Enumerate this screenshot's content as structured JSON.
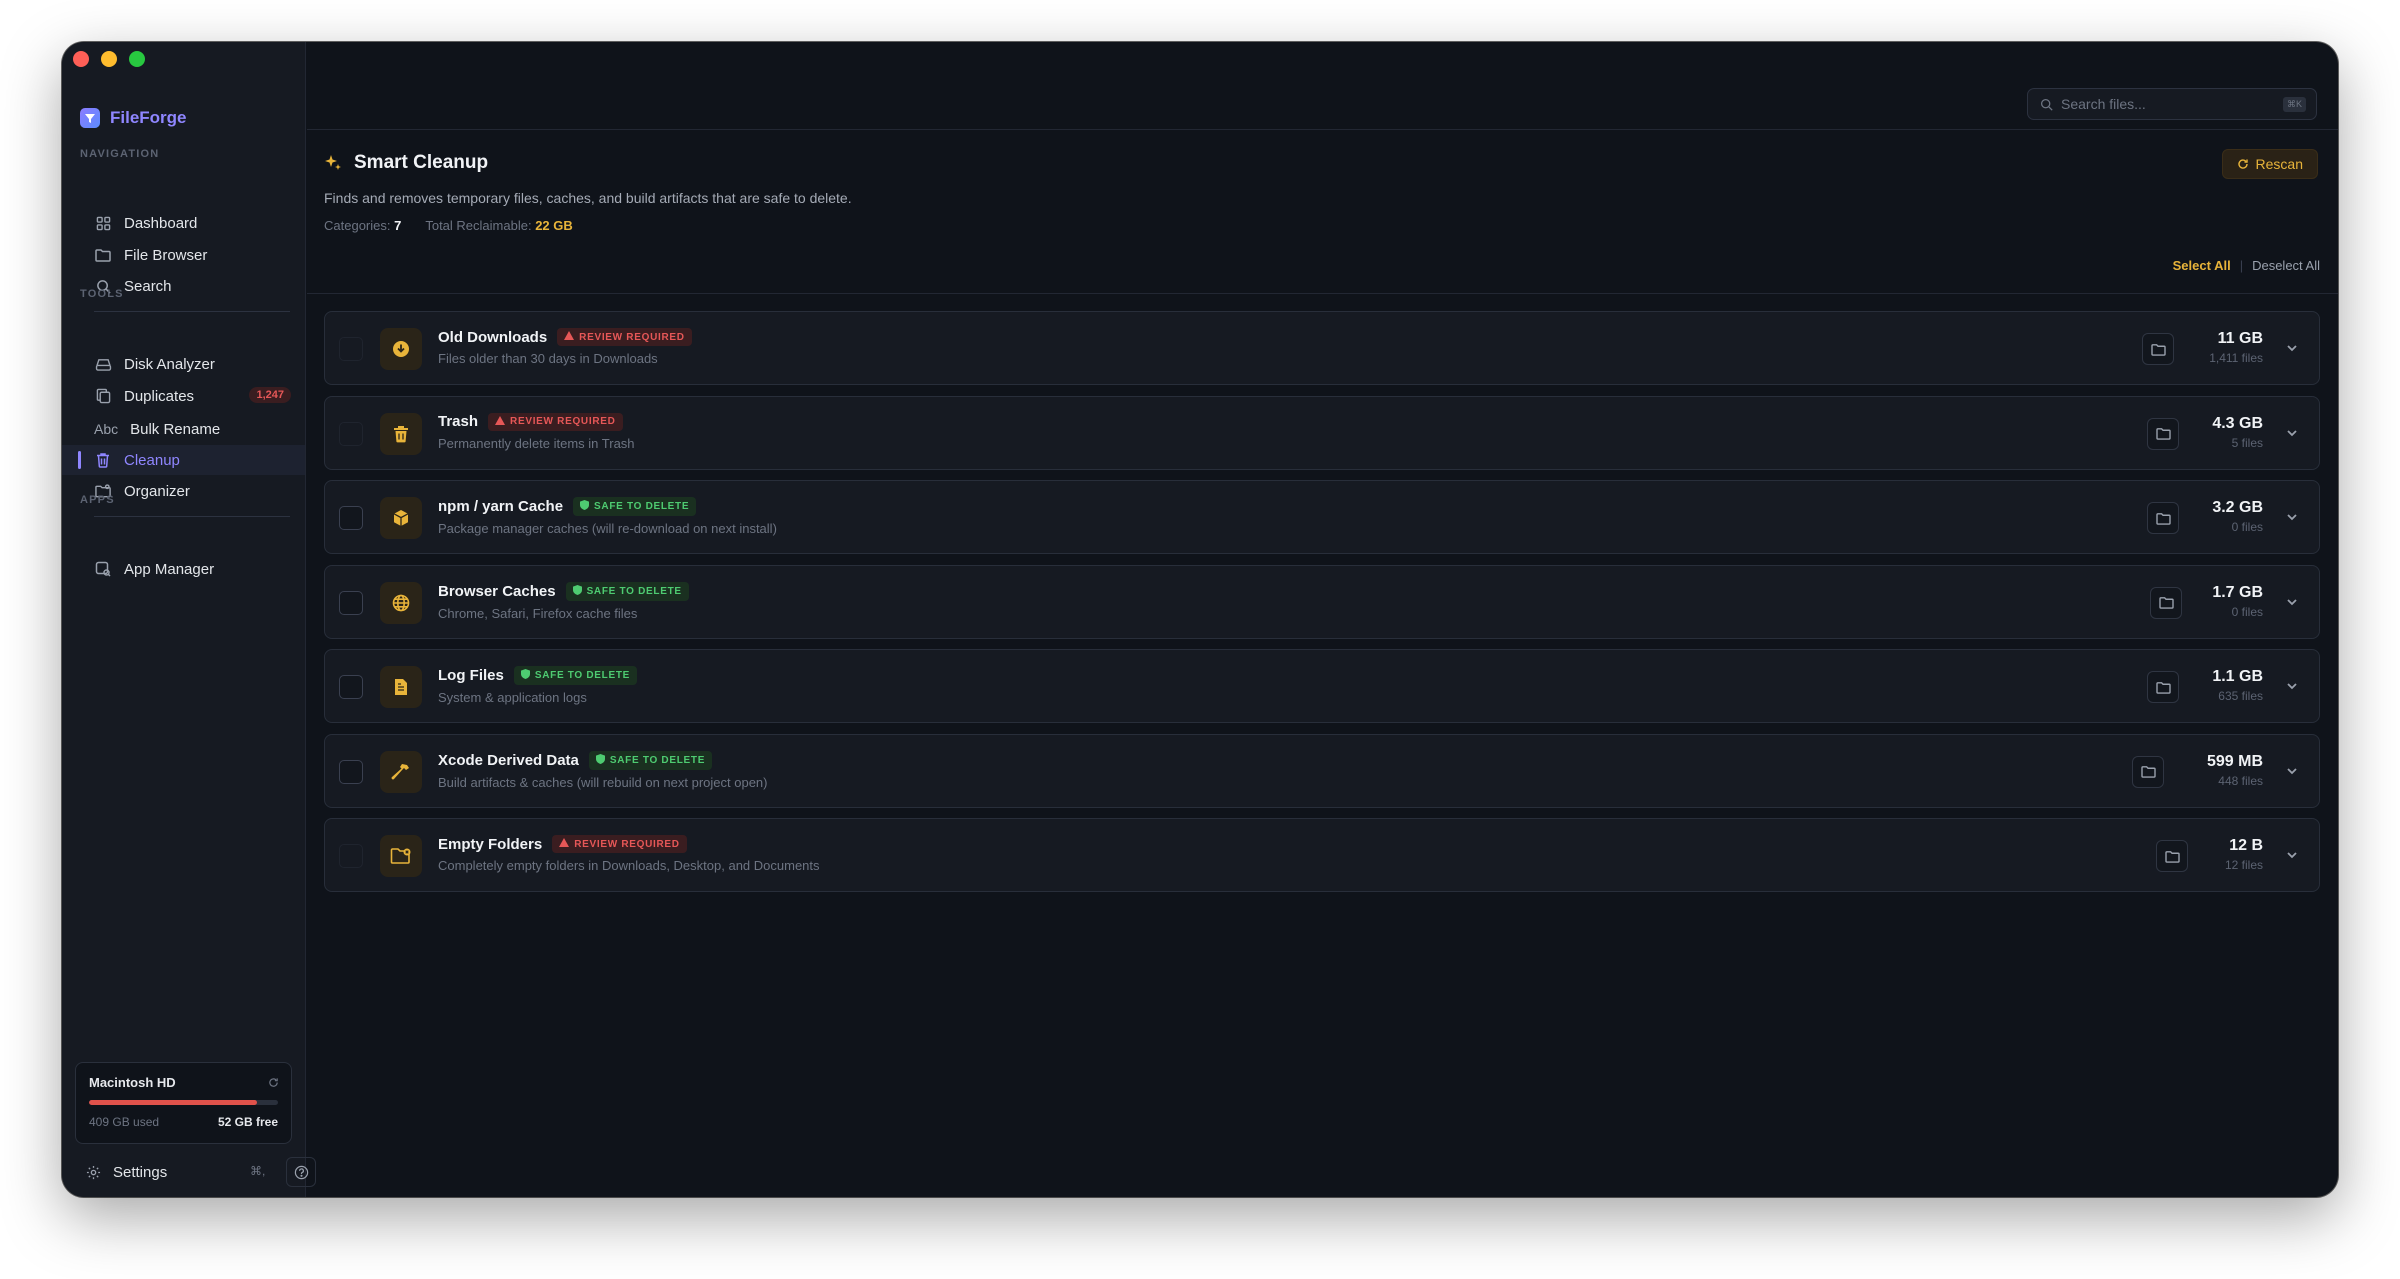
{
  "app": {
    "name": "FileForge"
  },
  "sidebar": {
    "sections": {
      "navigation": "NAVIGATION",
      "tools": "TOOLS",
      "apps": "APPS"
    },
    "navigation": [
      {
        "label": "Dashboard",
        "icon": "grid-icon"
      },
      {
        "label": "File Browser",
        "icon": "folder-icon"
      },
      {
        "label": "Search",
        "icon": "search-icon"
      }
    ],
    "tools": [
      {
        "label": "Disk Analyzer",
        "icon": "drive-icon"
      },
      {
        "label": "Duplicates",
        "icon": "copy-icon",
        "badge": "1,247"
      },
      {
        "label": "Bulk Rename",
        "icon": "abc-icon",
        "icon_text": "Abc"
      },
      {
        "label": "Cleanup",
        "icon": "trash-icon",
        "active": true
      },
      {
        "label": "Organizer",
        "icon": "folder-cog-icon"
      }
    ],
    "apps": [
      {
        "label": "App Manager",
        "icon": "app-search-icon"
      }
    ],
    "disk": {
      "name": "Macintosh HD",
      "used": "409 GB used",
      "free": "52 GB free",
      "used_fraction": 0.89
    },
    "settings": {
      "label": "Settings",
      "shortcut": "⌘,"
    }
  },
  "search": {
    "placeholder": "Search files...",
    "shortcut": "⌘K"
  },
  "header": {
    "title": "Smart Cleanup",
    "subtitle": "Finds and removes temporary files, caches, and build artifacts that are safe to delete.",
    "categories_label": "Categories:",
    "categories_value": "7",
    "reclaimable_label": "Total Reclaimable:",
    "reclaimable_value": "22 GB",
    "rescan_label": "Rescan",
    "select_all": "Select All",
    "deselect_all": "Deselect All"
  },
  "colors": {
    "accent": "#8f86ff",
    "amber": "#e8b43a",
    "danger": "#e65757",
    "safe": "#4ecb71"
  },
  "categories": [
    {
      "name": "Old Downloads",
      "badge": "REVIEW REQUIRED",
      "status": "review",
      "desc": "Files older than 30 days in Downloads",
      "size": "11 GB",
      "files": "1,411 files",
      "icon": "download-icon"
    },
    {
      "name": "Trash",
      "badge": "REVIEW REQUIRED",
      "status": "review",
      "desc": "Permanently delete items in Trash",
      "size": "4.3 GB",
      "files": "5 files",
      "icon": "trash-icon"
    },
    {
      "name": "npm / yarn Cache",
      "badge": "SAFE TO DELETE",
      "status": "safe",
      "desc": "Package manager caches (will re-download on next install)",
      "size": "3.2 GB",
      "files": "0 files",
      "icon": "package-icon"
    },
    {
      "name": "Browser Caches",
      "badge": "SAFE TO DELETE",
      "status": "safe",
      "desc": "Chrome, Safari, Firefox cache files",
      "size": "1.7 GB",
      "files": "0 files",
      "icon": "globe-icon"
    },
    {
      "name": "Log Files",
      "badge": "SAFE TO DELETE",
      "status": "safe",
      "desc": "System & application logs",
      "size": "1.1 GB",
      "files": "635 files",
      "icon": "document-icon"
    },
    {
      "name": "Xcode Derived Data",
      "badge": "SAFE TO DELETE",
      "status": "safe",
      "desc": "Build artifacts & caches (will rebuild on next project open)",
      "size": "599 MB",
      "files": "448 files",
      "icon": "hammer-icon"
    },
    {
      "name": "Empty Folders",
      "badge": "REVIEW REQUIRED",
      "status": "review",
      "desc": "Completely empty folders in Downloads, Desktop, and Documents",
      "size": "12 B",
      "files": "12 files",
      "icon": "folder-x-icon"
    }
  ]
}
